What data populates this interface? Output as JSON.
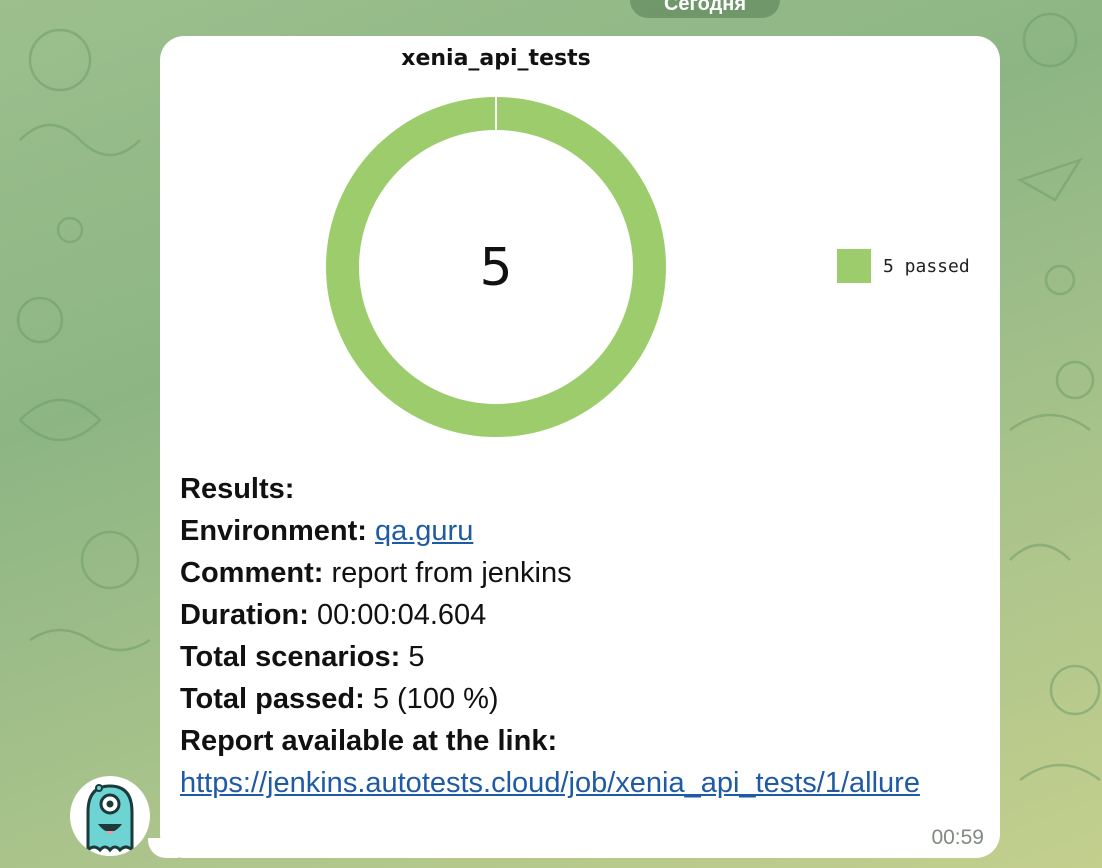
{
  "date_pill": {
    "label": "Сегодня"
  },
  "message": {
    "chart_title": "xenia_api_tests",
    "time": "00:59",
    "results": {
      "heading": "Results:",
      "environment_label": "Environment:",
      "environment_value": "qa.guru",
      "comment_label": "Comment:",
      "comment_value": "report from jenkins",
      "duration_label": "Duration:",
      "duration_value": "00:00:04.604",
      "total_scenarios_label": "Total scenarios:",
      "total_scenarios_value": "5",
      "total_passed_label": "Total passed:",
      "total_passed_value": "5 (100 %)",
      "report_label": "Report available at the link:",
      "report_link": "https://jenkins.autotests.cloud/job/xenia_api_tests/1/allure"
    }
  },
  "chart_data": {
    "type": "pie",
    "title": "xenia_api_tests",
    "center_label": "5",
    "slices": [
      {
        "name": "5 passed",
        "value": 5,
        "color": "#9ccc6b"
      }
    ],
    "legend_position": "right"
  },
  "colors": {
    "passed": "#9ccc6b",
    "link": "#1f5aa5",
    "bubble": "#ffffff"
  },
  "avatar": {
    "icon": "one-eyed-monster-icon"
  }
}
